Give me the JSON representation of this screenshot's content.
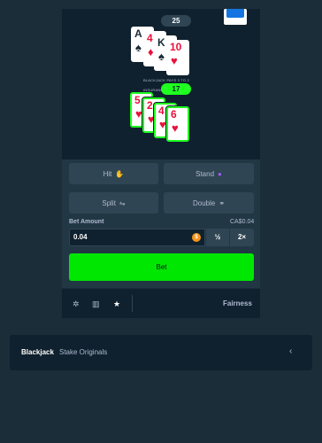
{
  "dealer": {
    "score": "25",
    "cards": [
      {
        "rank": "A",
        "suit": "♠",
        "color": "black"
      },
      {
        "rank": "4",
        "suit": "♦",
        "color": "red"
      },
      {
        "rank": "K",
        "suit": "♠",
        "color": "black"
      },
      {
        "rank": "10",
        "suit": "♥",
        "color": "red"
      }
    ]
  },
  "player": {
    "score": "17",
    "cards": [
      {
        "rank": "5",
        "suit": "♥",
        "color": "red"
      },
      {
        "rank": "2",
        "suit": "♥",
        "color": "red"
      },
      {
        "rank": "4",
        "suit": "♥",
        "color": "red"
      },
      {
        "rank": "6",
        "suit": "♥",
        "color": "red"
      }
    ]
  },
  "table_text": {
    "line1": "BLACKJACK PAYS 3 TO 2",
    "line2": "INSURANCE PAYS 2 TO 1"
  },
  "actions": {
    "hit": "Hit",
    "stand": "Stand",
    "split": "Split",
    "double": "Double"
  },
  "bet": {
    "label": "Bet Amount",
    "converted": "CA$0.04",
    "value": "0.04",
    "half": "½",
    "double": "2×",
    "button": "Bet",
    "currency_icon": "coin-icon"
  },
  "footer": {
    "fairness": "Fairness"
  },
  "info": {
    "title": "Blackjack",
    "subtitle": "Stake Originals",
    "chevron": "‹"
  },
  "colors": {
    "background": "#1b2d38",
    "table": "#0f212e",
    "panel": "#213743",
    "button": "#2f4553",
    "accent_green": "#00e701",
    "win_green": "#1fff20",
    "card_red": "#e9113c"
  }
}
